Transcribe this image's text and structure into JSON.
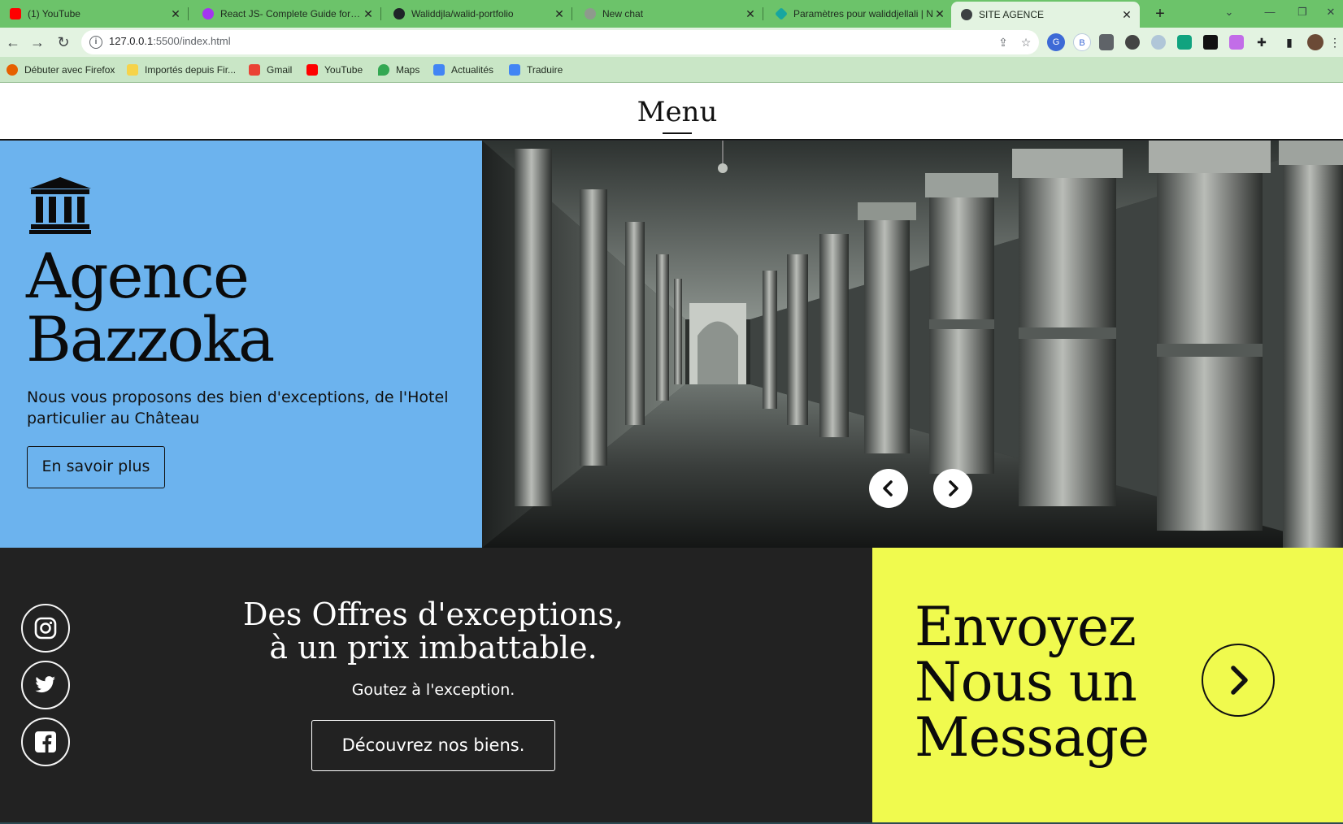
{
  "browser": {
    "tabs": [
      {
        "title": "(1) YouTube",
        "fav_color": "#ff0000"
      },
      {
        "title": "React JS- Complete Guide for Fr",
        "fav_color": "#a435f0"
      },
      {
        "title": "Waliddjla/walid-portfolio",
        "fav_color": "#1f2328"
      },
      {
        "title": "New chat",
        "fav_color": "#8e9a8d"
      },
      {
        "title": "Paramètres pour waliddjellali | N",
        "fav_color": "#17a6a0"
      },
      {
        "title": "SITE AGENCE",
        "fav_color": "#3c4043"
      }
    ],
    "tab_close": "✕",
    "new_tab": "+",
    "url_host": "127.0.0.1",
    "url_rest": ":5500/index.html",
    "bookmarks": [
      {
        "label": "Débuter avec Firefox",
        "color": "#e66000"
      },
      {
        "label": "Importés depuis Fir...",
        "color": "#f6d34a"
      },
      {
        "label": "Gmail",
        "color": "#ea4335"
      },
      {
        "label": "YouTube",
        "color": "#ff0000"
      },
      {
        "label": "Maps",
        "color": "#34a853"
      },
      {
        "label": "Actualités",
        "color": "#4285f4"
      },
      {
        "label": "Traduire",
        "color": "#4285f4"
      }
    ],
    "extensions": [
      {
        "label": "B",
        "color": "#ffffff",
        "text": "#3d6ad6"
      }
    ]
  },
  "page": {
    "menu_title": "Menu",
    "hero": {
      "title_line1": "Agence",
      "title_line2": "Bazzoka",
      "description": "Nous vous proposons des bien d'exceptions, de l'Hotel particulier au Château",
      "cta": "En savoir plus"
    },
    "offer": {
      "title_line1": "Des Offres d'exceptions,",
      "title_line2": "à un prix imbattable.",
      "subtitle": "Goutez à l'exception.",
      "cta": "Découvrez nos biens."
    },
    "contact": {
      "line1": "Envoyez",
      "line2": "Nous un",
      "line3": "Message"
    },
    "colors": {
      "hero_blue": "#6cb3ee",
      "dark": "#222222",
      "yellow": "#f0fa4e"
    }
  }
}
